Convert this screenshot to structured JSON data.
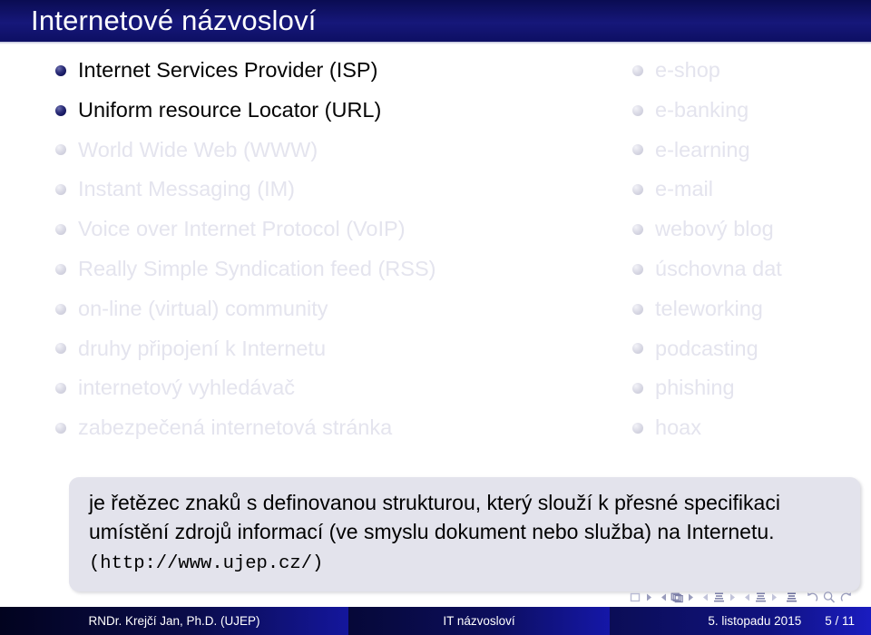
{
  "slide": {
    "title": "Internetové názvosloví",
    "colors": {
      "title_bar": "#0d0f63",
      "title_text": "#ffffff",
      "active_text": "#040404",
      "dim_text": "#e4e4ee",
      "active_bullet": "#14165e",
      "dim_bullet": "#cfcfdd",
      "box_background": "#e3e3ec",
      "footer_background": "#10127e"
    }
  },
  "left_column": {
    "items": [
      {
        "label": "Internet Services Provider (ISP)",
        "state": "active"
      },
      {
        "label": "Uniform resource Locator (URL)",
        "state": "active"
      },
      {
        "label": "World Wide Web (WWW)",
        "state": "dim"
      },
      {
        "label": "Instant Messaging (IM)",
        "state": "dim"
      },
      {
        "label": "Voice over Internet Protocol (VoIP)",
        "state": "dim"
      },
      {
        "label": "Really Simple Syndication feed (RSS)",
        "state": "dim"
      },
      {
        "label": "on-line (virtual) community",
        "state": "dim"
      },
      {
        "label": "druhy připojení k Internetu",
        "state": "dim"
      },
      {
        "label": "internetový vyhledávač",
        "state": "dim"
      },
      {
        "label": "zabezpečená internetová stránka",
        "state": "dim"
      }
    ]
  },
  "right_column": {
    "items": [
      {
        "label": "e-shop",
        "state": "dim"
      },
      {
        "label": "e-banking",
        "state": "dim"
      },
      {
        "label": "e-learning",
        "state": "dim"
      },
      {
        "label": "e-mail",
        "state": "dim"
      },
      {
        "label": "webový blog",
        "state": "dim"
      },
      {
        "label": "úschovna dat",
        "state": "dim"
      },
      {
        "label": "teleworking",
        "state": "dim"
      },
      {
        "label": "podcasting",
        "state": "dim"
      },
      {
        "label": "phishing",
        "state": "dim"
      },
      {
        "label": "hoax",
        "state": "dim"
      }
    ]
  },
  "definition": {
    "body": "je řetězec znaků s definovanou strukturou, který slouží k přesné specifikaci umístění zdrojů informací (ve smyslu dokument nebo služba) na Internetu. ",
    "url": "(http://www.ujep.cz/)"
  },
  "navigation": {
    "symbols": [
      "previous-frame-icon",
      "next-frame-icon",
      "previous-slide-icon",
      "slide-icon",
      "next-slide-icon",
      "previous-subsection-icon",
      "subsection-icon",
      "next-subsection-icon",
      "previous-section-icon",
      "section-icon",
      "next-section-icon",
      "document-icon",
      "back-icon",
      "search-icon",
      "forward-icon"
    ]
  },
  "footer": {
    "author": "RNDr. Krejčí Jan, Ph.D.  (UJEP)",
    "subject": "IT názvosloví",
    "date": "5. listopadu 2015",
    "page": "5 / 11"
  }
}
